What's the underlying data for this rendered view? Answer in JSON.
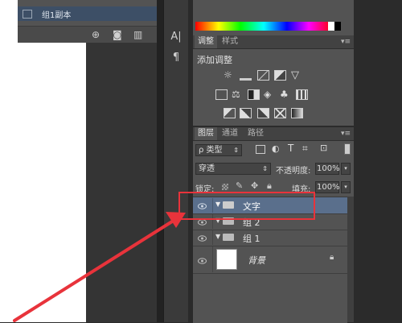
{
  "layers_top_panel": {
    "selected_layer_label": "组1副本"
  },
  "tool_strip": {
    "icons": [
      "character-icon",
      "paragraph-icon"
    ]
  },
  "adjustments_panel": {
    "tabs": [
      "调整",
      "样式"
    ],
    "title": "添加调整"
  },
  "layers_panel": {
    "tabs": [
      "图层",
      "通道",
      "路径"
    ],
    "filter_label": "ρ 类型",
    "blend_mode": "穿透",
    "opacity_label": "不透明度:",
    "opacity_value": "100%",
    "lock_label": "锁定:",
    "fill_label": "填充:",
    "fill_value": "100%",
    "layers": [
      {
        "name": "文字",
        "type": "group",
        "selected": true
      },
      {
        "name": "组 2",
        "type": "group",
        "selected": false
      },
      {
        "name": "组 1",
        "type": "group",
        "selected": false
      },
      {
        "name": "背景",
        "type": "background",
        "selected": false
      }
    ]
  },
  "annotation": {
    "color": "#e8333b"
  }
}
